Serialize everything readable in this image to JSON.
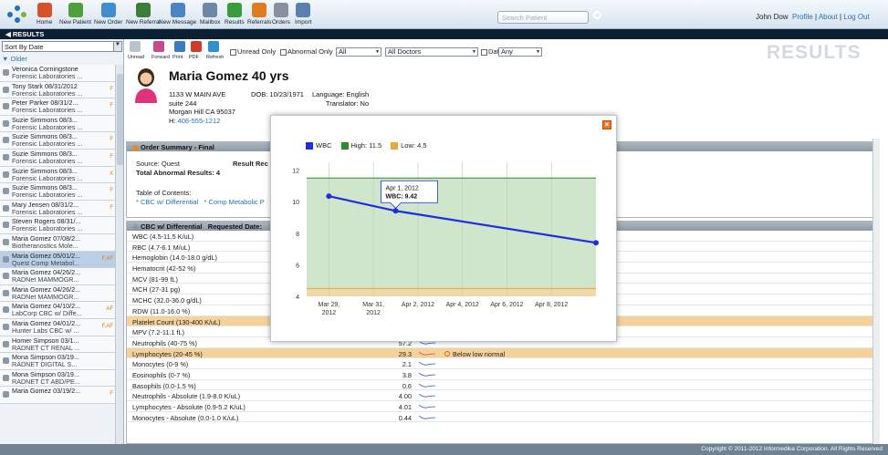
{
  "toolbar": {
    "items": [
      {
        "label": "Home",
        "icon": "home-icon"
      },
      {
        "label": "New Patient",
        "icon": "new-patient-icon"
      },
      {
        "label": "New Order",
        "icon": "new-order-icon"
      },
      {
        "label": "New Referral",
        "icon": "new-referral-icon"
      },
      {
        "label": "New Message",
        "icon": "new-message-icon"
      },
      {
        "label": "Mailbox",
        "icon": "mailbox-icon"
      },
      {
        "label": "Results",
        "icon": "results-icon"
      },
      {
        "label": "Referrals",
        "icon": "referrals-icon"
      },
      {
        "label": "Orders",
        "icon": "orders-icon"
      },
      {
        "label": "Import",
        "icon": "import-icon"
      }
    ],
    "search_placeholder": "Search Patient",
    "user": "John Dow",
    "profile": "Profile",
    "about": "About",
    "logout": "Log Out"
  },
  "section_title": "RESULTS",
  "section_watermark": "RESULTS",
  "left": {
    "sort": "Sort By Date",
    "older": "Older",
    "items": [
      {
        "l1": "Veronica Corningstone",
        "l2": "Forensic Laboratories ...",
        "flag": ""
      },
      {
        "l1": "Tony Stark 08/31/2012",
        "l2": "Forensic Laboratories ...",
        "flag": "F"
      },
      {
        "l1": "Peter Parker 08/31/2...",
        "l2": "Forensic Laboratories ...",
        "flag": "F"
      },
      {
        "l1": "Suzie Simmons 08/3...",
        "l2": "Forensic Laboratories ...",
        "flag": ""
      },
      {
        "l1": "Suzie Simmons 08/3...",
        "l2": "Forensic Laboratories ...",
        "flag": "F"
      },
      {
        "l1": "Suzie Simmons 08/3...",
        "l2": "Forensic Laboratories ...",
        "flag": "F"
      },
      {
        "l1": "Suzie Simmons 08/3...",
        "l2": "Forensic Laboratories ...",
        "flag": "X"
      },
      {
        "l1": "Suzie Simmons 08/3...",
        "l2": "Forensic Laboratories ...",
        "flag": "F"
      },
      {
        "l1": "Mary Jensen 08/31/2...",
        "l2": "Forensic Laboratories ...",
        "flag": "F"
      },
      {
        "l1": "Steven Rogers 08/31/...",
        "l2": "Forensic Laboratories ...",
        "flag": ""
      },
      {
        "l1": "Maria Gomez 07/08/2...",
        "l2": "Biotheranostics Mole...",
        "flag": ""
      },
      {
        "l1": "Maria Gomez 05/01/2...",
        "l2": "Quest Comp Metabol...",
        "flag": "F,AF"
      },
      {
        "l1": "Maria Gomez 04/26/2...",
        "l2": "RADNet MAMMOGR...",
        "flag": ""
      },
      {
        "l1": "Maria Gomez 04/26/2...",
        "l2": "RADNet MAMMOGR...",
        "flag": ""
      },
      {
        "l1": "Maria Gomez 04/10/2...",
        "l2": "LabCorp CBC w/ Diffe...",
        "flag": "AF"
      },
      {
        "l1": "Maria Gomez 04/01/2...",
        "l2": "Hunter Labs CBC w/ ...",
        "flag": "F,AF"
      },
      {
        "l1": "Homer Simpson 03/1...",
        "l2": "RADNET CT RENAL ...",
        "flag": ""
      },
      {
        "l1": "Mona Simpson 03/19...",
        "l2": "RADNET DIGITAL S...",
        "flag": ""
      },
      {
        "l1": "Mona Simpson 03/19...",
        "l2": "RADNET CT ABD/PE...",
        "flag": ""
      },
      {
        "l1": "Maria Gomez 03/19/2...",
        "l2": "",
        "flag": "F"
      }
    ]
  },
  "filters": {
    "mini": [
      "Unread",
      "Forward",
      "Print",
      "PDF",
      "Refresh"
    ],
    "unread_only": "Unread Only",
    "abnormal_only": "Abnormal Only",
    "all": "All",
    "all_doctors": "All Doctors",
    "date_label": "Date",
    "date_value": "Any"
  },
  "patient": {
    "name": "Maria Gomez 40 yrs",
    "addr1": "1133 W MAIN AVE",
    "addr2": "suite 244",
    "addr3": "Morgan Hill CA 95037",
    "phone_label": "H:",
    "phone": "408-555-1212",
    "dob": "DOB: 10/23/1971",
    "language": "Language: English",
    "translator": "Translator: No"
  },
  "order_summary": {
    "title": "Order Summary - Final",
    "source": "Source: Quest",
    "result_rec": "Result Rec",
    "abnormal": "Total Abnormal Results: 4",
    "toc": "Table of Contents:",
    "link1": "* CBC w/ Differential",
    "link2": "* Comp Metabolic P"
  },
  "cbc": {
    "title": "CBC w/ Differential",
    "requested": "Requested Date:",
    "rows": [
      {
        "label": "WBC (4.5-11.5 K/uL)",
        "value": "",
        "note": "",
        "hl": false
      },
      {
        "label": "RBC (4.7-6.1 M/uL)",
        "value": "",
        "note": "",
        "hl": false
      },
      {
        "label": "Hemoglobin (14.0-18.0 g/dL)",
        "value": "",
        "note": "",
        "hl": false
      },
      {
        "label": "Hematocrit (42-52 %)",
        "value": "",
        "note": "",
        "hl": false
      },
      {
        "label": "MCV (81-99 fL)",
        "value": "",
        "note": "",
        "hl": false
      },
      {
        "label": "MCH (27-31 pg)",
        "value": "",
        "note": "",
        "hl": false
      },
      {
        "label": "MCHC (32.0-36.0 g/dL)",
        "value": "",
        "note": "",
        "hl": false
      },
      {
        "label": "RDW (11.0-16.0 %)",
        "value": "",
        "note": "",
        "hl": false
      },
      {
        "label": "Platelet Count (130-400 K/uL)",
        "value": "",
        "note": "",
        "hl": true
      },
      {
        "label": "MPV (7.2-11.1 fL)",
        "value": "10.3",
        "note": "",
        "hl": false
      },
      {
        "label": "Neutrophils (40-75 %)",
        "value": "57.2",
        "note": "",
        "hl": false
      },
      {
        "label": "Lymphocytes (20-45 %)",
        "value": "29.3",
        "note": "Below low normal",
        "hl": true
      },
      {
        "label": "Monocytes (0-9 %)",
        "value": "2.1",
        "note": "",
        "hl": false
      },
      {
        "label": "Eosinophils (0-7 %)",
        "value": "3.8",
        "note": "",
        "hl": false
      },
      {
        "label": "Basophils (0.0-1.5 %)",
        "value": "0.6",
        "note": "",
        "hl": false
      },
      {
        "label": "Neutrophils - Absolute (1.9-8.0 K/uL)",
        "value": "4.00",
        "note": "",
        "hl": false
      },
      {
        "label": "Lymphocytes - Absolute (0.9-5.2 K/uL)",
        "value": "4.01",
        "note": "",
        "hl": false
      },
      {
        "label": "Monocytes - Absolute (0.0-1.0 K/uL)",
        "value": "0.44",
        "note": "",
        "hl": false
      }
    ]
  },
  "footer": "Copyright © 2011-2012 Informedika Corporation. All Rights Reserved",
  "chart_data": {
    "type": "line",
    "series": [
      {
        "name": "WBC",
        "color": "#1f2fe0",
        "x": [
          "2012-03-29",
          "2012-04-01",
          "2012-04-10"
        ],
        "values": [
          10.35,
          9.42,
          7.4
        ]
      }
    ],
    "bands": [
      {
        "name": "High: 11.5",
        "color": "#2e8b2e",
        "value": 11.5
      },
      {
        "name": "Low: 4.5",
        "color": "#e8a83a",
        "value": 4.5
      }
    ],
    "tooltip": {
      "date": "Apr 1, 2012",
      "label": "WBC: 9.42"
    },
    "x_ticks": [
      {
        "date": "2012-03-29",
        "l1": "Mar 29,",
        "l2": "2012"
      },
      {
        "date": "2012-03-31",
        "l1": "Mar 31,",
        "l2": "2012"
      },
      {
        "date": "2012-04-02",
        "l1": "Apr 2, 2012",
        "l2": ""
      },
      {
        "date": "2012-04-04",
        "l1": "Apr 4, 2012",
        "l2": ""
      },
      {
        "date": "2012-04-06",
        "l1": "Apr 6, 2012",
        "l2": ""
      },
      {
        "date": "2012-04-08",
        "l1": "Apr 8, 2012",
        "l2": ""
      }
    ],
    "y_ticks": [
      4,
      6,
      8,
      10,
      12
    ],
    "ylim": [
      4,
      12.5
    ],
    "xlim": [
      "2012-03-28",
      "2012-04-10"
    ],
    "grid": true
  }
}
